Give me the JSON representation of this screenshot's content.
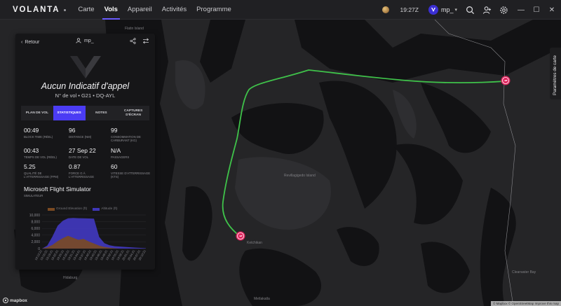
{
  "app": {
    "brand": "VOLANTA",
    "nav": [
      "Carte",
      "Vols",
      "Appareil",
      "Activités",
      "Programme"
    ],
    "active_nav": "Vols"
  },
  "topbar": {
    "time": "19:27Z",
    "user": "mp_"
  },
  "panel": {
    "back_label": "Retour",
    "pilot": "mp_",
    "callsign": "Aucun Indicatif d'appel",
    "flight_line": "N° de vol • G21 • DQ-AYL",
    "tabs": [
      "PLAN DE VOL",
      "STATISTIQUES",
      "NOTES",
      "CAPTURES D'ÉCRAN"
    ],
    "active_tab": "STATISTIQUES",
    "stats": [
      {
        "value": "00:49",
        "label": "BLOCK TIME (RÉEL)"
      },
      {
        "value": "96",
        "label": "DISTANCE (NM)"
      },
      {
        "value": "99",
        "label": "CONSOMMATION DE CARBURANT (KG)"
      },
      {
        "value": "00:43",
        "label": "TEMPS DE VOL (RÉEL)"
      },
      {
        "value": "27 Sep 22",
        "label": "DATE DE VOL"
      },
      {
        "value": "N/A",
        "label": "PASSAGERS"
      },
      {
        "value": "5.25",
        "label": "QUALITÉ DE L'ATTERRISSAGE (FPM)"
      },
      {
        "value": "0.87",
        "label": "FORCE G À L'ATTERRISSAGE"
      },
      {
        "value": "60",
        "label": "VITESSE D'ATTERRISSAGE (KTS)"
      }
    ],
    "simulator": {
      "value": "Microsoft Flight Simulator",
      "label": "SIMULATEUR"
    }
  },
  "chart_data": {
    "type": "area",
    "series": [
      {
        "name": "Ground Elevation (ft)",
        "color": "#7a4a22",
        "values": [
          0,
          400,
          1100,
          2200,
          3100,
          3800,
          3200,
          2600,
          2900,
          2100,
          1500,
          900,
          500,
          250,
          100,
          0,
          0,
          0,
          0,
          0,
          0
        ]
      },
      {
        "name": "Altitude (ft)",
        "color": "#3f37b8",
        "values": [
          0,
          900,
          3600,
          6800,
          8300,
          9000,
          9100,
          9050,
          9000,
          8950,
          8900,
          3500,
          1600,
          1000,
          700,
          600,
          500,
          400,
          300,
          200,
          100
        ]
      }
    ],
    "y_ticks": [
      "10,000",
      "8,000",
      "6,000",
      "4,000",
      "2,000",
      "0"
    ],
    "x_ticks": [
      "19:13:21",
      "19:16:21",
      "19:19:21",
      "19:22:21",
      "19:25:21",
      "19:28:21",
      "19:31:21",
      "19:34:21",
      "19:37:21",
      "19:40:21",
      "19:43:21",
      "19:46:21",
      "19:49:21",
      "19:52:21",
      "19:55:21",
      "19:58:21",
      "20:01:21",
      "20:04:21",
      "20:07:21",
      "20:10:21"
    ],
    "ylim": [
      0,
      10000
    ]
  },
  "map": {
    "labels": [
      "Flatin Island",
      "Revillagigedo Island",
      "Ketchikan",
      "Metlakatla",
      "Hidaburg",
      "Clearwater Bay"
    ],
    "settings_label": "Paramètres de carte",
    "attribution": "© Mapbox © OpenStreetMap  Improve this map",
    "provider": "mapbox",
    "route_color": "#3fc24a"
  }
}
